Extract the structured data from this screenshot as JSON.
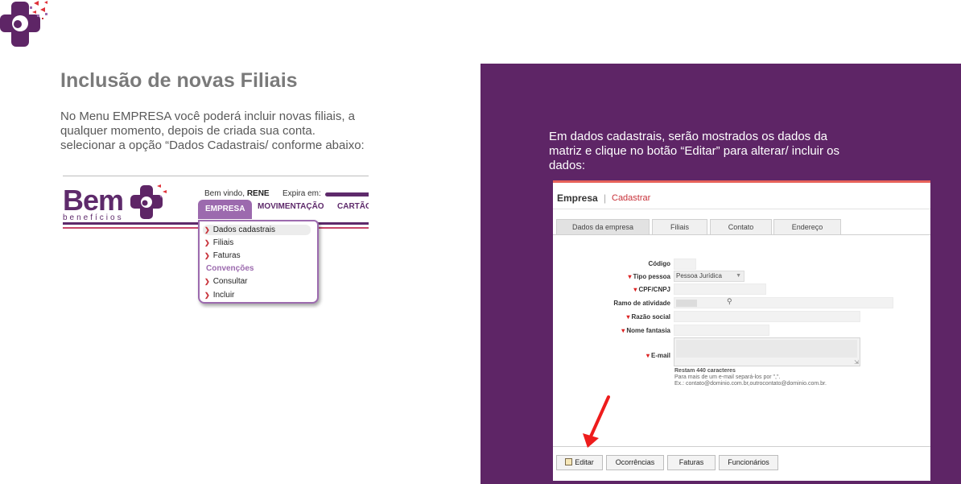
{
  "slide": {
    "title": "Inclusão de novas Filiais",
    "body_line1": "No Menu EMPRESA você poderá incluir novas filiais, a",
    "body_line2": "qualquer momento, depois de criada sua conta.",
    "body_line3": "selecionar a opção “Dados Cadastrais/ conforme abaixo:"
  },
  "menu_screenshot": {
    "logo_word": "Bem",
    "logo_sub": "benefícios",
    "welcome_prefix": "Bem vindo,",
    "welcome_user": "RENE",
    "expira_label": "Expira em:",
    "nav": {
      "empresa": "EMPRESA",
      "movimentacao": "MOVIMENTAÇÃO",
      "cartao": "CARTÃO"
    },
    "dropdown": {
      "item1": "Dados cadastrais",
      "item2": "Filiais",
      "item3": "Faturas",
      "group": "Convenções",
      "item4": "Consultar",
      "item5": "Incluir"
    }
  },
  "right_panel": {
    "text_line1": "Em dados cadastrais, serão mostrados os dados da",
    "text_line2": "matriz e clique no botão “Editar” para alterar/ incluir os",
    "text_line3": "dados:"
  },
  "form_screenshot": {
    "header_title": "Empresa",
    "header_sep": "|",
    "header_sub": "Cadastrar",
    "tabs": [
      "Dados da empresa",
      "Filiais",
      "Contato",
      "Endereço"
    ],
    "fields": {
      "codigo": "Código",
      "tipo_pessoa": "Tipo pessoa",
      "tipo_pessoa_value": "Pessoa Jurídica",
      "cpf_cnpj": "CPF/CNPJ",
      "ramo": "Ramo de atividade",
      "razao": "Razão social",
      "nome_fantasia": "Nome fantasia",
      "email": "E-mail"
    },
    "hint_line1": "Restam 440 caracteres",
    "hint_line2": "Para mais de um e-mail separá-los por \",\".",
    "hint_line3": "Ex.: contato@dominio.com.br,outrocontato@dominio.com.br.",
    "buttons": [
      "Editar",
      "Ocorrências",
      "Faturas",
      "Funcionários"
    ]
  },
  "colors": {
    "brand_purple": "#5e2566",
    "accent_red": "#c8323a",
    "menu_purple": "#9c6aae"
  }
}
